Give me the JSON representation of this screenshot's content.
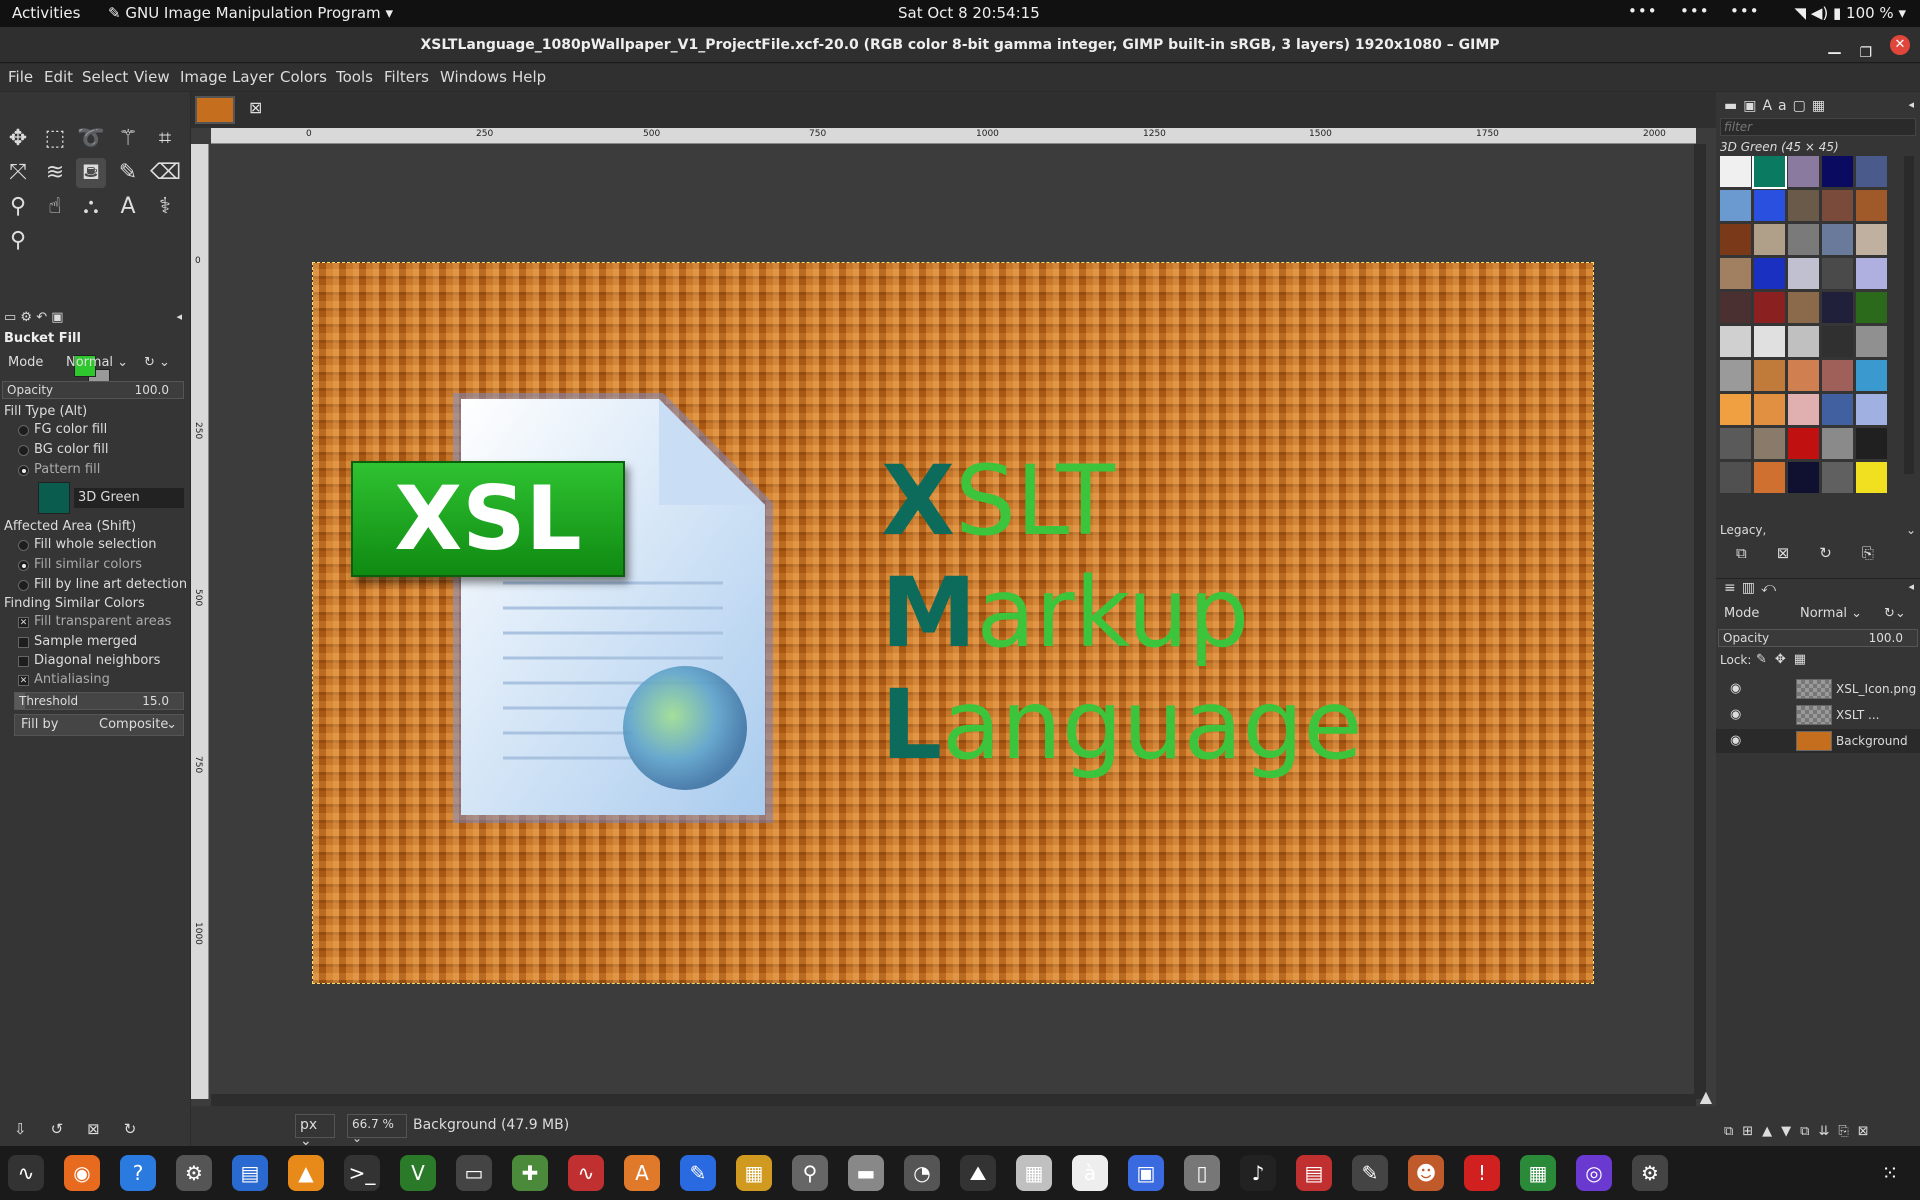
{
  "topbar": {
    "activities": "Activities",
    "app_name": "GNU Image Manipulation Program",
    "clock": "Sat Oct 8  20:54:15",
    "battery": "100 %"
  },
  "window": {
    "title": "XSLTLanguage_1080pWallpaper_V1_ProjectFile.xcf-20.0 (RGB color 8-bit gamma integer, GIMP built-in sRGB, 3 layers) 1920x1080 – GIMP"
  },
  "menu": [
    "File",
    "Edit",
    "Select",
    "View",
    "Image",
    "Layer",
    "Colors",
    "Tools",
    "Filters",
    "Windows",
    "Help"
  ],
  "tool_options": {
    "title": "Bucket Fill",
    "mode_label": "Mode",
    "mode_value": "Normal",
    "opacity_label": "Opacity",
    "opacity_value": "100.0",
    "fill_type_label": "Fill Type  (Alt)",
    "fill_types": [
      "FG color fill",
      "BG color fill",
      "Pattern fill"
    ],
    "pattern_name": "3D Green",
    "affected_label": "Affected Area  (Shift)",
    "affected": [
      "Fill whole selection",
      "Fill similar colors",
      "Fill by line art detection"
    ],
    "similar_label": "Finding Similar Colors",
    "options": [
      "Fill transparent areas",
      "Sample merged",
      "Diagonal neighbors",
      "Antialiasing"
    ],
    "threshold_label": "Threshold",
    "threshold_value": "15.0",
    "fill_by_label": "Fill by",
    "fill_by_value": "Composite"
  },
  "colors": {
    "fg": "#2ec72e",
    "bg": "#999999",
    "accent_dark": "#0c6b5a",
    "accent_green": "#3cc43c"
  },
  "ruler": {
    "h_labels": [
      "0",
      "250",
      "500",
      "750",
      "1000",
      "1250",
      "1500",
      "1750",
      "2000"
    ],
    "v_labels": [
      "0",
      "250",
      "500",
      "750",
      "1000"
    ]
  },
  "artwork": {
    "icon_text": "XSL",
    "lines": [
      {
        "first": "X",
        "rest": "SLT"
      },
      {
        "first": "M",
        "rest": "arkup"
      },
      {
        "first": "L",
        "rest": "anguage"
      }
    ]
  },
  "status": {
    "unit": "px",
    "zoom": "66.7 %",
    "layer_info": "Background (47.9 MB)"
  },
  "patterns": {
    "filter_placeholder": "filter",
    "current": "3D Green (45 × 45)",
    "tag": "Legacy,"
  },
  "layers": {
    "mode_label": "Mode",
    "mode_value": "Normal",
    "opacity_label": "Opacity",
    "opacity_value": "100.0",
    "lock_label": "Lock:",
    "items": [
      {
        "name": "XSL_Icon.png"
      },
      {
        "name": "XSLT ..."
      },
      {
        "name": "Background"
      }
    ]
  }
}
